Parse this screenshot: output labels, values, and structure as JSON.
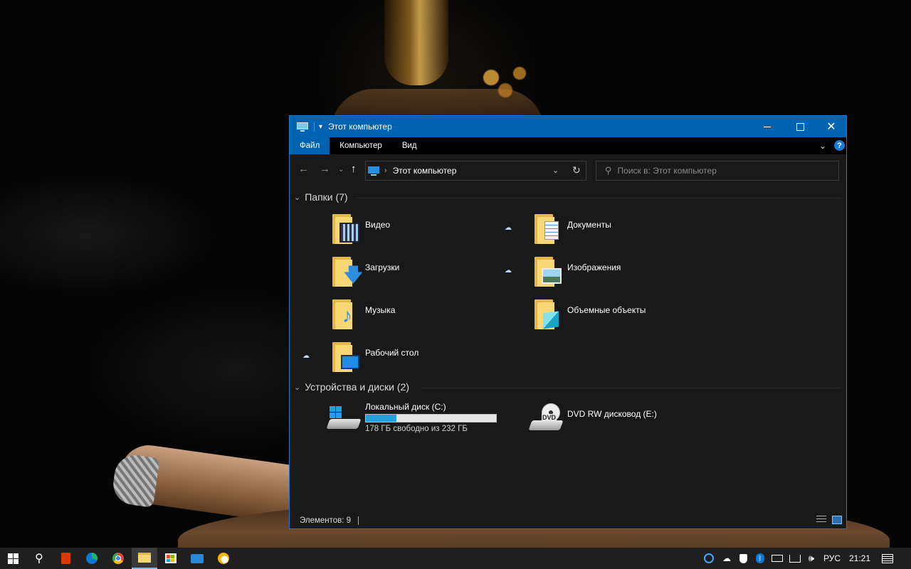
{
  "window": {
    "title": "Этот компьютер",
    "qa_dropdown": "▾",
    "controls": {
      "minimize": "",
      "maximize": "",
      "close": "✕"
    }
  },
  "ribbon": {
    "tabs": [
      {
        "label": "Файл",
        "active": true
      },
      {
        "label": "Компьютер",
        "active": false
      },
      {
        "label": "Вид",
        "active": false
      }
    ],
    "expand": "⌄",
    "help": "?"
  },
  "nav": {
    "back": "←",
    "forward": "→",
    "recent": "⌄",
    "up": "↑",
    "address": "Этот компьютер",
    "address_sep": "›",
    "address_dropdown": "⌄",
    "refresh": "↻",
    "search_placeholder": "Поиск в: Этот компьютер"
  },
  "folders_group": {
    "title": "Папки (7)",
    "items": [
      {
        "name": "Видео",
        "icon": "video-folder-icon",
        "cloud": false
      },
      {
        "name": "Документы",
        "icon": "documents-folder-icon",
        "cloud": true
      },
      {
        "name": "Загрузки",
        "icon": "downloads-folder-icon",
        "cloud": false
      },
      {
        "name": "Изображения",
        "icon": "pictures-folder-icon",
        "cloud": true
      },
      {
        "name": "Музыка",
        "icon": "music-folder-icon",
        "cloud": false
      },
      {
        "name": "Объемные объекты",
        "icon": "3d-objects-folder-icon",
        "cloud": false
      },
      {
        "name": "Рабочий стол",
        "icon": "desktop-folder-icon",
        "cloud": true
      }
    ]
  },
  "devices_group": {
    "title": "Устройства и диски (2)",
    "drives": [
      {
        "name": "Локальный диск (C:)",
        "free": "178 ГБ свободно из 232 ГБ",
        "used_fraction": 0.233,
        "icon": "local-disk-icon"
      },
      {
        "name": "DVD RW дисковод (E:)",
        "icon": "dvd-drive-icon",
        "label": "DVD"
      }
    ]
  },
  "status": {
    "items": "Элементов: 9"
  },
  "taskbar": {
    "tray": {
      "language": "РУС",
      "time": "21:21"
    }
  },
  "colors": {
    "accent": "#0063b1",
    "window_bg": "#191919",
    "folder": "#f8d775",
    "usage_fill": "#26a0da"
  }
}
